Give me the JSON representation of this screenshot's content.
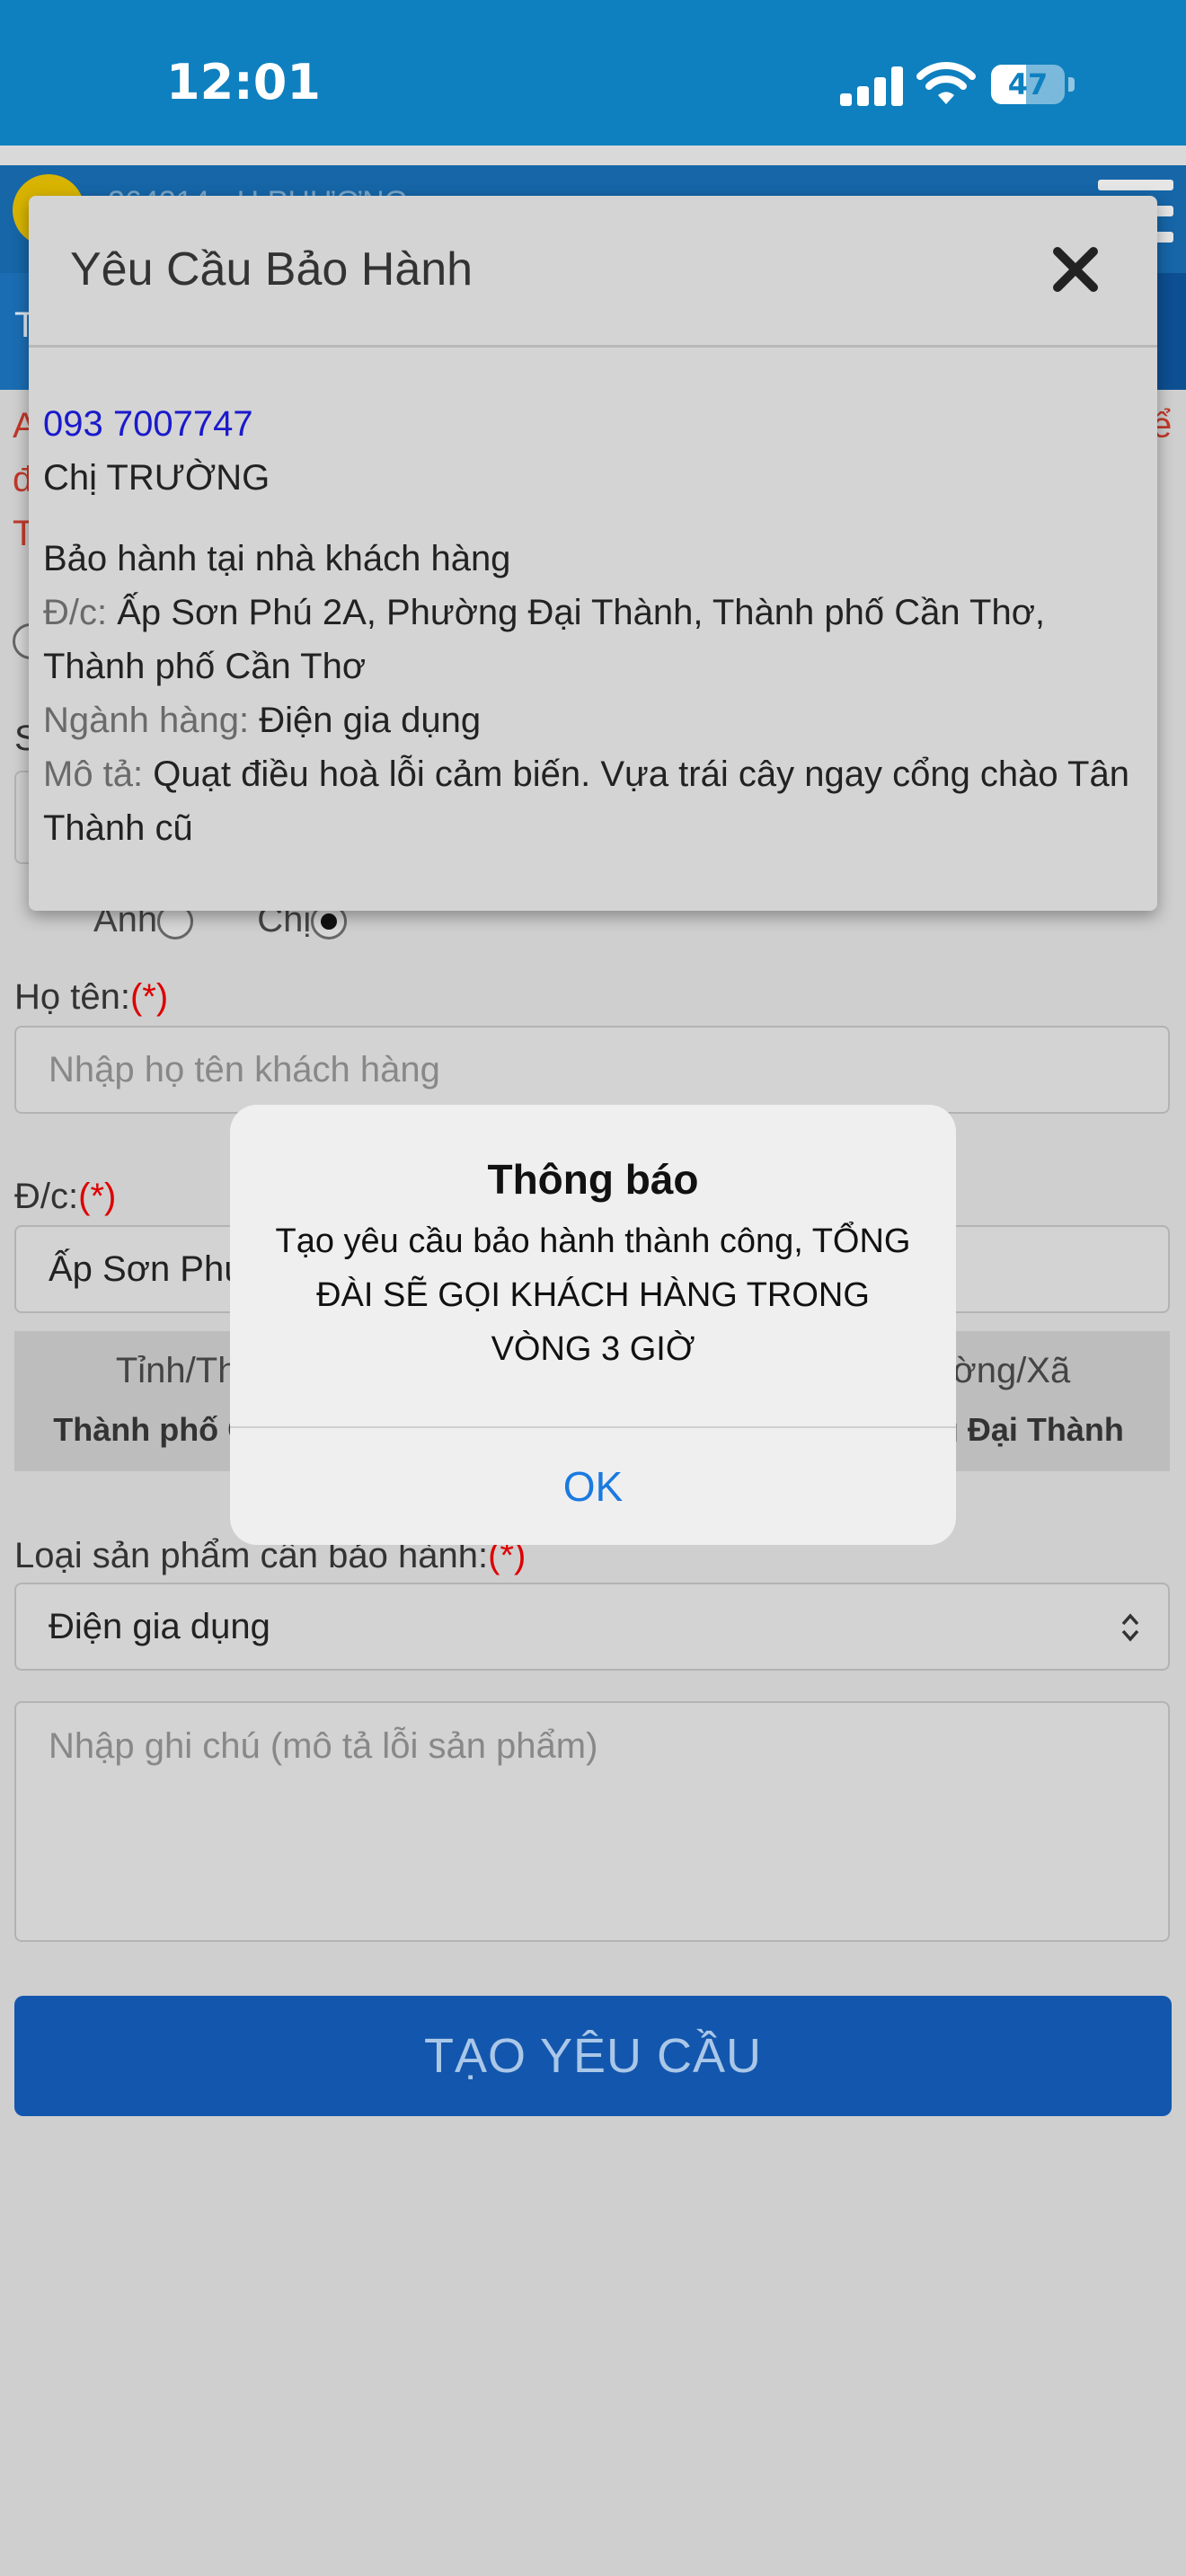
{
  "status_bar": {
    "time": "12:01",
    "battery": "47",
    "battery_level": 0.47
  },
  "app_header": {
    "username": "264214 - H.PHƯƠNG"
  },
  "page": {
    "title_letter": "T",
    "warning_letters": [
      "A",
      "đ",
      "T"
    ],
    "warning_right": "ể",
    "section_letter": "S",
    "gender_options": [
      {
        "label": "Anh",
        "selected": false
      },
      {
        "label": "Chị",
        "selected": true
      }
    ],
    "name_label": "Họ tên:",
    "required_mark": "(*)",
    "name_placeholder": "Nhập họ tên khách hàng",
    "address_label": "Đ/c:",
    "address_value": "Ấp Sơn Phú 2A",
    "location": {
      "province_header": "Tỉnh/Thành",
      "province_value": "Thành phố Cần Thơ",
      "ward_header": "Phường/Xã",
      "ward_value": "Phường Đại Thành"
    },
    "product_label": "Loại sản phẩm cần bảo hành:",
    "product_value": "Điện gia dụng",
    "notes_placeholder": "Nhập ghi chú (mô tả lỗi sản phẩm)",
    "submit_label": "TẠO YÊU CẦU"
  },
  "modal": {
    "title": "Yêu Cầu Bảo Hành",
    "phone": "093 7007747",
    "customer": "Chị TRƯỜNG",
    "service": "Bảo hành tại nhà khách hàng",
    "address_label": "Đ/c:",
    "address": "Ấp Sơn Phú 2A, Phường Đại Thành, Thành phố Cần Thơ, Thành phố Cần Thơ",
    "category_label": "Ngành hàng:",
    "category": "Điện gia dụng",
    "description_label": "Mô tả:",
    "description": "Quạt điều hoà lỗi cảm biến. Vựa trái cây ngay cổng chào Tân Thành cũ"
  },
  "alert": {
    "title": "Thông báo",
    "message": "Tạo yêu cầu bảo hành thành công, TỔNG ĐÀI SẼ GỌI KHÁCH HÀNG TRONG VÒNG 3 GIỜ",
    "ok_label": "OK"
  },
  "colors": {
    "status_bar": "#0e80bf",
    "submit": "#1356ad",
    "link": "#1a7ae0",
    "required": "#dd0000"
  }
}
